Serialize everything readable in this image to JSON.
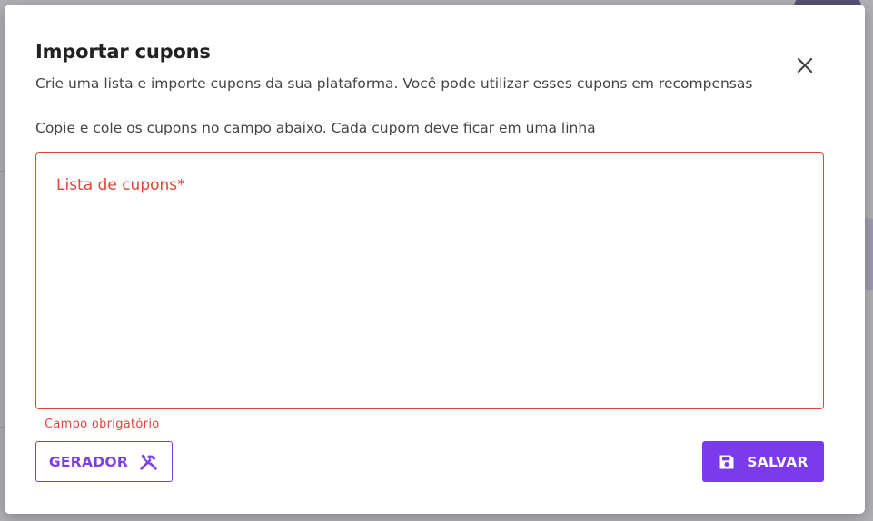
{
  "dialog": {
    "title": "Importar cupons",
    "subtitle": "Crie uma lista e importe cupons da sua plataforma. Você pode utilizar esses cupons em recompensas",
    "instructions": "Copie e cole os cupons no campo abaixo. Cada cupom deve ficar em uma linha",
    "close_icon": "close-icon"
  },
  "coupon_field": {
    "label": "Lista de cupons*",
    "value": "",
    "error": "Campo obrigatório"
  },
  "actions": {
    "generator_label": "GERADOR",
    "generator_icon": "hammer-wrench-icon",
    "save_label": "SALVAR",
    "save_icon": "floppy-disk-icon"
  },
  "colors": {
    "accent": "#7c3aed",
    "error": "#e0453a",
    "overlay": "rgba(80,80,90,0.45)"
  }
}
